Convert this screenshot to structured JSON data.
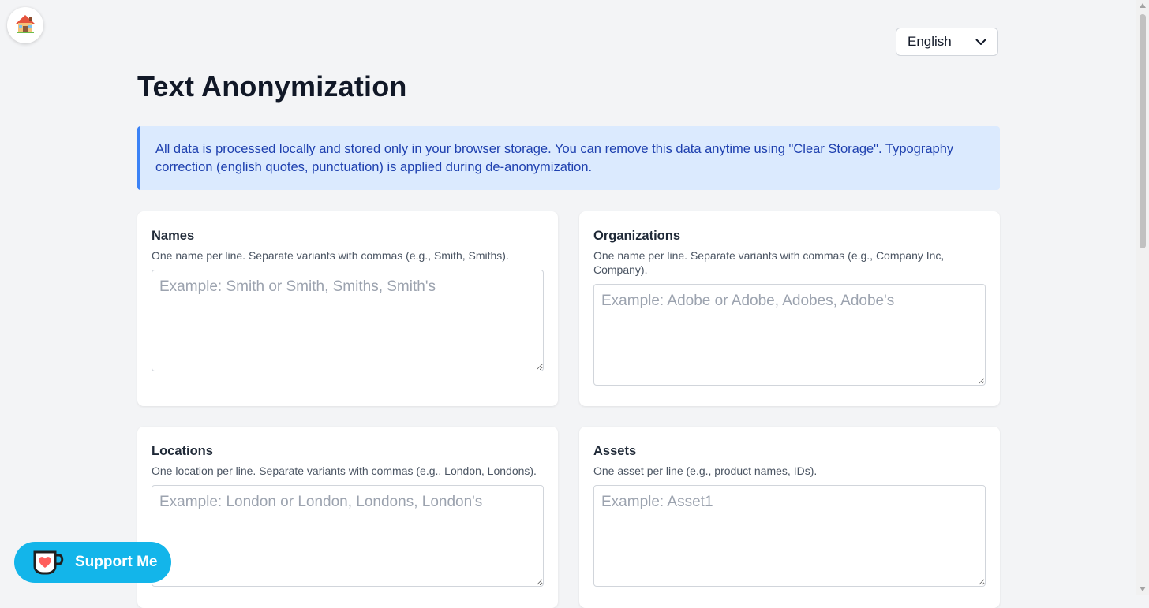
{
  "icons": {
    "home": "house-emoji-icon",
    "language_caret": "chevron-down-icon",
    "support": "coffee-cup-heart-icon"
  },
  "language": {
    "selected": "English"
  },
  "title": "Text Anonymization",
  "info_banner": "All data is processed locally and stored only in your browser storage. You can remove this data anytime using \"Clear Storage\". Typography correction (english quotes, punctuation) is applied during de-anonymization.",
  "cards": {
    "names": {
      "title": "Names",
      "hint": "One name per line. Separate variants with commas (e.g., Smith, Smiths).",
      "placeholder": "Example: Smith or Smith, Smiths, Smith's"
    },
    "organizations": {
      "title": "Organizations",
      "hint": "One name per line. Separate variants with commas (e.g., Company Inc, Company).",
      "placeholder": "Example: Adobe or Adobe, Adobes, Adobe's"
    },
    "locations": {
      "title": "Locations",
      "hint": "One location per line. Separate variants with commas (e.g., London, Londons).",
      "placeholder": "Example: London or London, Londons, London's"
    },
    "assets": {
      "title": "Assets",
      "hint": "One asset per line (e.g., product names, IDs).",
      "placeholder": "Example: Asset1"
    }
  },
  "support": {
    "label": "Support Me"
  },
  "colors": {
    "page_bg": "#f3f4f6",
    "info_bg": "#dbeafe",
    "info_border": "#3b82f6",
    "info_text": "#1e40af",
    "support_bg": "#13b5ea"
  }
}
